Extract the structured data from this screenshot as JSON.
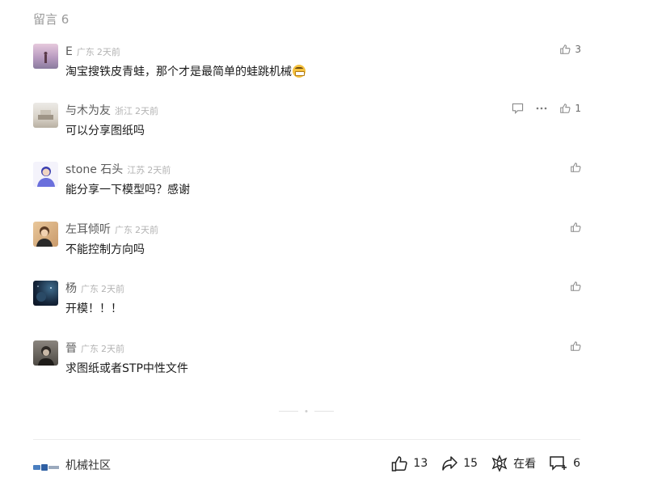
{
  "header": {
    "title": "留言 6"
  },
  "comments": [
    {
      "nick": "E",
      "location": "广东",
      "time": "2天前",
      "content": "淘宝搜铁皮青蛙，那个才是最简单的蛙跳机械",
      "likes": "3",
      "avatar_color": "#c9b6c9"
    },
    {
      "nick": "与木为友",
      "location": "浙江",
      "time": "2天前",
      "content": "可以分享图纸吗",
      "likes": "1",
      "avatar_color": "#d9d4cc"
    },
    {
      "nick": "stone 石头",
      "location": "江苏",
      "time": "2天前",
      "content": "能分享一下模型吗？感谢",
      "likes": "",
      "avatar_color": "#7a7ee0"
    },
    {
      "nick": "左耳倾听",
      "location": "广东",
      "time": "2天前",
      "content": "不能控制方向吗",
      "likes": "",
      "avatar_color": "#d4a878"
    },
    {
      "nick": "杨",
      "location": "广东",
      "time": "2天前",
      "content": "开模！！！",
      "likes": "",
      "avatar_color": "#1b3046"
    },
    {
      "nick": "晉",
      "location": "广东",
      "time": "2天前",
      "content": "求图纸或者STP中性文件",
      "likes": "",
      "avatar_color": "#5b5650"
    }
  ],
  "footer": {
    "brand": "机械社区",
    "like_count": "13",
    "share_count": "15",
    "wow_label": "在看",
    "comment_count": "6"
  },
  "icons": {
    "like": "thumbs-up-icon",
    "reply": "reply-bubble-icon",
    "more": "more-dots-icon",
    "share": "share-arrow-icon",
    "wow": "flower-icon",
    "comment": "comment-plus-icon"
  }
}
